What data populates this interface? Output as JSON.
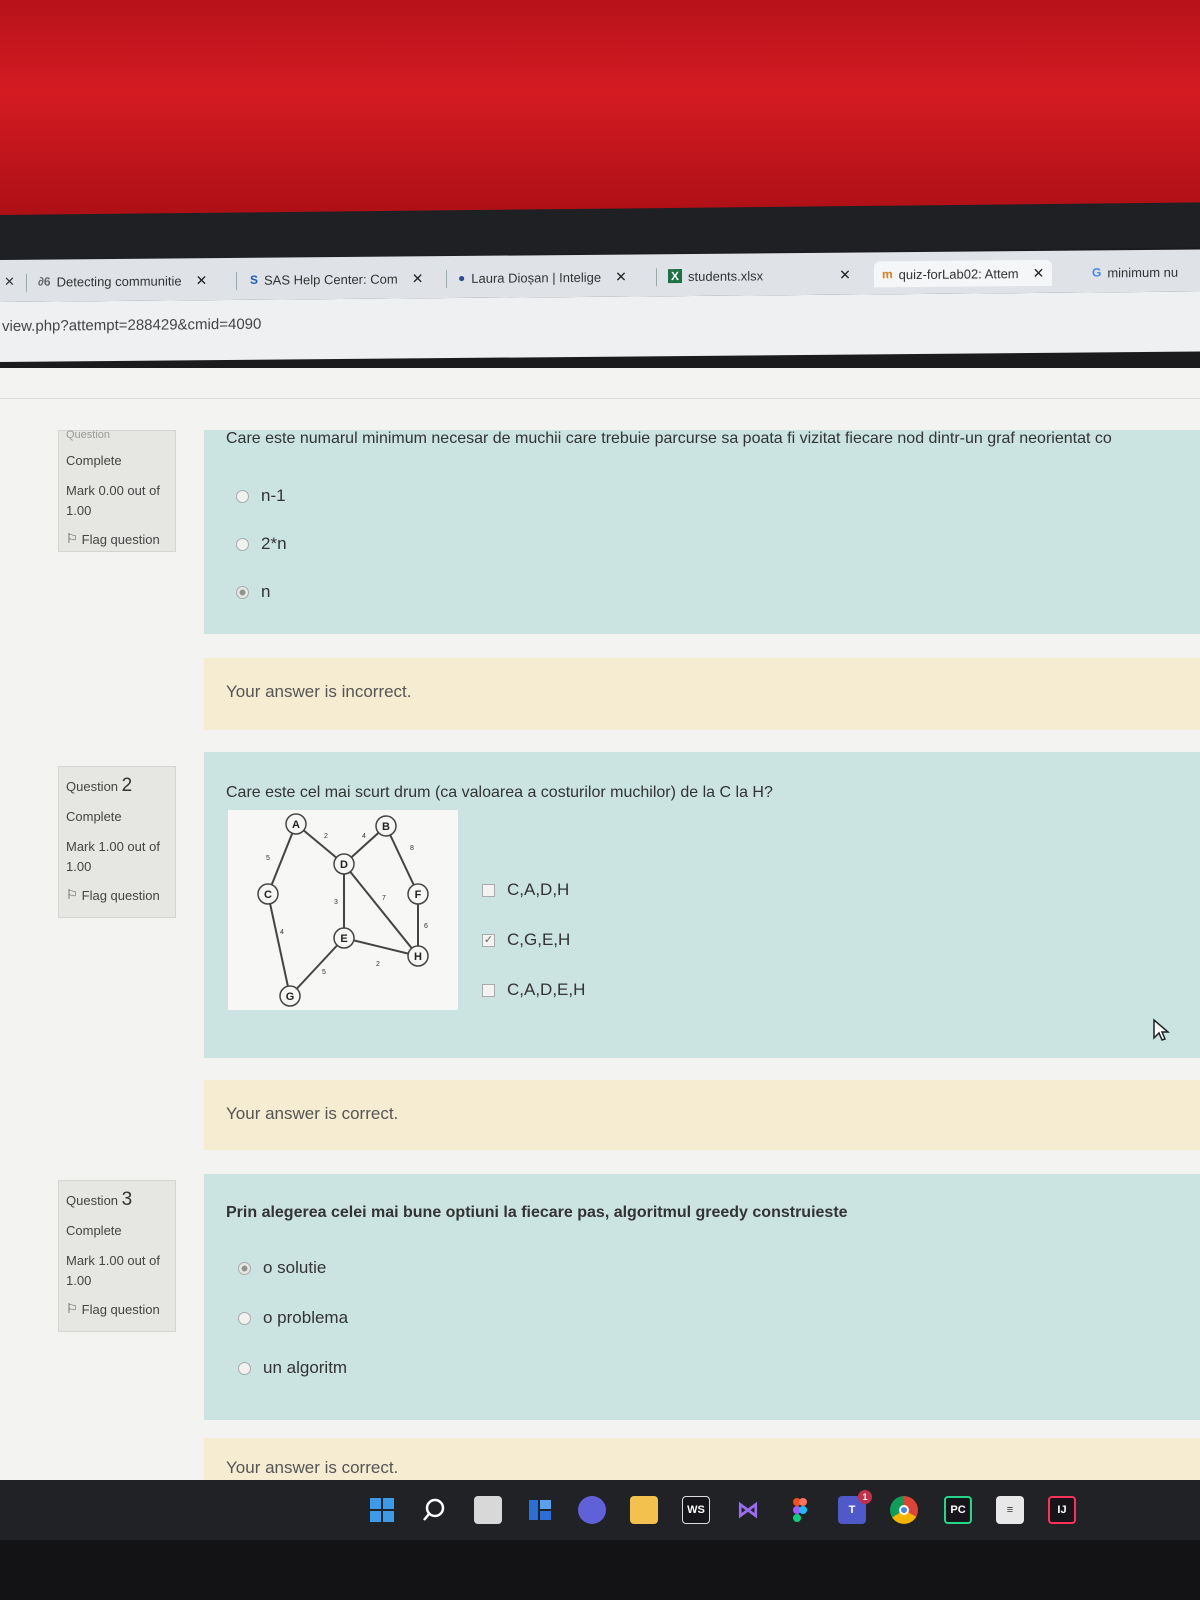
{
  "browser": {
    "tabs": [
      {
        "icon": "✕",
        "label": ""
      },
      {
        "icon": "∂6",
        "label": "Detecting communitie",
        "close": "✕"
      },
      {
        "icon": "S",
        "label": "SAS Help Center: Com",
        "close": "✕"
      },
      {
        "icon": "●",
        "label": "Laura Dioșan | Intelige",
        "close": "✕"
      },
      {
        "icon": "X",
        "label": "students.xlsx",
        "close": "✕"
      },
      {
        "icon": "m",
        "label": "quiz-forLab02: Attem",
        "close": "✕"
      },
      {
        "icon": "G",
        "label": "minimum nu"
      }
    ],
    "url": "view.php?attempt=288429&cmid=4090"
  },
  "questions": [
    {
      "number_label": "Question",
      "number": "",
      "status": "Complete",
      "mark": "Mark 0.00 out of 1.00",
      "flag": "Flag question",
      "text": "Care este numarul minimum necesar de muchii care trebuie parcurse sa poata fi vizitat fiecare nod dintr-un graf neorientat co",
      "options": [
        "n-1",
        "2*n",
        "n"
      ],
      "feedback": "Your answer is incorrect."
    },
    {
      "number_label": "Question",
      "number": "2",
      "status": "Complete",
      "mark": "Mark 1.00 out of 1.00",
      "flag": "Flag question",
      "text": "Care este cel mai scurt drum (ca valoarea a costurilor muchilor) de la C la H?",
      "options": [
        "C,A,D,H",
        "C,G,E,H",
        "C,A,D,E,H"
      ],
      "feedback": "Your answer is correct."
    },
    {
      "number_label": "Question",
      "number": "3",
      "status": "Complete",
      "mark": "Mark 1.00 out of 1.00",
      "flag": "Flag question",
      "text": "Prin alegerea celei mai bune optiuni la fiecare pas, algoritmul greedy construieste",
      "options": [
        "o solutie",
        "o problema",
        "un algoritm"
      ],
      "feedback": "Your answer is correct."
    }
  ],
  "graph": {
    "nodes": [
      "A",
      "B",
      "C",
      "D",
      "E",
      "F",
      "G",
      "H"
    ],
    "edge_weights": [
      "2",
      "4",
      "5",
      "8",
      "3",
      "7",
      "4",
      "6",
      "2",
      "5"
    ]
  },
  "taskbar": {
    "items": [
      "windows-icon",
      "search-icon",
      "task-view-icon",
      "widgets-icon",
      "chat-icon",
      "file-explorer-icon",
      "webstorm-icon",
      "visual-studio-icon",
      "figma-icon",
      "teams-icon",
      "chrome-icon",
      "pycharm-icon",
      "notepad-icon",
      "intellij-icon"
    ],
    "labels": {
      "webstorm": "WS",
      "teams": "T",
      "teams_badge": "1",
      "pycharm": "PC",
      "intellij": "IJ"
    }
  }
}
